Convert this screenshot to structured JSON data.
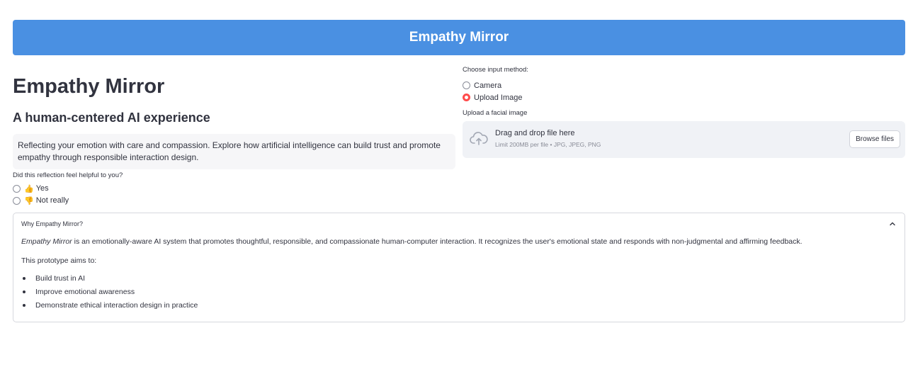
{
  "header": {
    "banner_title": "Empathy Mirror"
  },
  "main": {
    "title": "Empathy Mirror",
    "subtitle": "A human-centered AI experience",
    "info_text": "Reflecting your emotion with care and compassion. Explore how artificial intelligence can build trust and promote empathy through responsible interaction design.",
    "feedback": {
      "label": "Did this reflection feel helpful to you?",
      "options": [
        {
          "emoji": "👍",
          "label": "Yes",
          "selected": false
        },
        {
          "emoji": "👎",
          "label": "Not really",
          "selected": false
        }
      ]
    }
  },
  "input": {
    "method_label": "Choose input method:",
    "methods": [
      {
        "label": "Camera",
        "selected": false
      },
      {
        "label": "Upload Image",
        "selected": true
      }
    ],
    "upload_label": "Upload a facial image",
    "dropzone": {
      "icon": "cloud-upload-icon",
      "main_text": "Drag and drop file here",
      "sub_text": "Limit 200MB per file • JPG, JPEG, PNG",
      "browse_label": "Browse files"
    }
  },
  "expander": {
    "title": "Why Empathy Mirror?",
    "icon": "chevron-up-icon",
    "desc_emphasis": "Empathy Mirror",
    "desc_rest": " is an emotionally-aware AI system that promotes thoughtful, responsible, and compassionate human-computer interaction. It recognizes the user's emotional state and responds with non-judgmental and affirming feedback.",
    "aims_intro": "This prototype aims to:",
    "bullets": [
      "Build trust in AI",
      "Improve emotional awareness",
      "Demonstrate ethical interaction design in practice"
    ]
  },
  "colors": {
    "banner": "#4a90e2",
    "radio_selected": "#ff4b4b",
    "text": "#31333f",
    "panel_bg": "#f0f2f6"
  }
}
